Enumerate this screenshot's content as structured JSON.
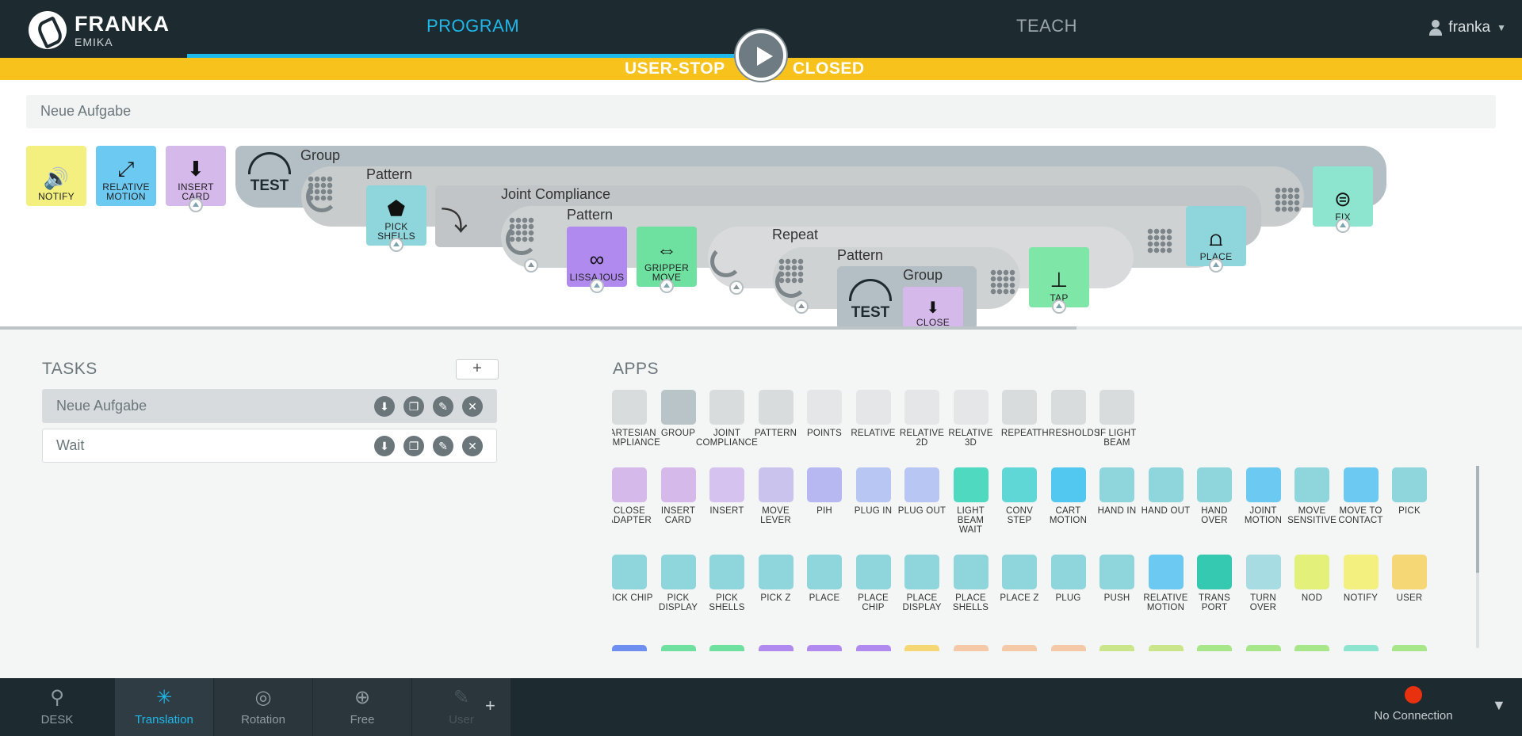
{
  "header": {
    "brand": "FRANKA",
    "brand_sub": "EMIKA",
    "tabs": [
      {
        "label": "PROGRAM",
        "active": true
      },
      {
        "label": "TEACH",
        "active": false
      }
    ],
    "user": "franka",
    "colors": {
      "bg": "#1d2a30",
      "accent": "#1fb8ea"
    }
  },
  "status": {
    "left": "USER-STOP",
    "right": "CLOSED",
    "color": "#f8c21c",
    "play_icon": "play-icon"
  },
  "task_name": "Neue Aufgabe",
  "timeline": {
    "tiles": [
      {
        "label": "NOTIFY",
        "color": "#f3f07f",
        "icon": "speaker-icon"
      },
      {
        "label": "RELATIVE MOTION",
        "color": "#6cc9f2",
        "icon": "relative-motion-icon"
      },
      {
        "label": "INSERT CARD",
        "color": "#d5b9ea",
        "icon": "insert-card-icon"
      },
      {
        "label": "PICK SHELLS",
        "color": "#8ed6dc",
        "icon": "gripper-icon"
      },
      {
        "label": "LISSAJOUS",
        "color": "#b18af0",
        "icon": "lissajous-icon"
      },
      {
        "label": "GRIPPER MOVE",
        "color": "#6ee0a0",
        "icon": "gripper-move-icon"
      },
      {
        "label": "CLOSE",
        "color": "#d5b9ea",
        "icon": "close-adapter-icon"
      },
      {
        "label": "TAP",
        "color": "#7ee6a6",
        "icon": "tap-icon"
      },
      {
        "label": "PLACE",
        "color": "#8ed6dc",
        "icon": "place-icon"
      },
      {
        "label": "FIX",
        "color": "#8de4cf",
        "icon": "fix-icon"
      }
    ],
    "groups": [
      "Group",
      "Pattern",
      "Joint Compliance",
      "Pattern",
      "Repeat",
      "Pattern",
      "Group"
    ],
    "test_label": "TEST"
  },
  "tasks": {
    "title": "TASKS",
    "add_label": "+",
    "items": [
      {
        "name": "Neue Aufgabe",
        "selected": true
      },
      {
        "name": "Wait",
        "selected": false
      }
    ],
    "action_icons": [
      "download-icon",
      "copy-icon",
      "edit-icon",
      "delete-icon"
    ]
  },
  "apps": {
    "title": "APPS",
    "items": [
      {
        "label": "CARTESIAN COMPLIANCE",
        "color": "#d9dcdd"
      },
      {
        "label": "GROUP",
        "color": "#b9c4c9"
      },
      {
        "label": "JOINT COMPLIANCE",
        "color": "#d9dcdd"
      },
      {
        "label": "PATTERN",
        "color": "#d9dcdd"
      },
      {
        "label": "POINTS",
        "color": "#e4e6e7"
      },
      {
        "label": "RELATIVE",
        "color": "#e4e6e7"
      },
      {
        "label": "RELATIVE 2D",
        "color": "#e4e6e7"
      },
      {
        "label": "RELATIVE 3D",
        "color": "#e4e6e7"
      },
      {
        "label": "REPEAT",
        "color": "#d9dcdd"
      },
      {
        "label": "THRESHOLDS",
        "color": "#d9dcdd"
      },
      {
        "label": "IF LIGHT BEAM",
        "color": "#d9dcdd"
      },
      {
        "label": "CLOSE ADAPTER",
        "color": "#d5b9ea"
      },
      {
        "label": "INSERT CARD",
        "color": "#d5b9ea"
      },
      {
        "label": "INSERT",
        "color": "#d5c2ee"
      },
      {
        "label": "MOVE LEVER",
        "color": "#c9c3ee"
      },
      {
        "label": "PIH",
        "color": "#b7b8f2"
      },
      {
        "label": "PLUG IN",
        "color": "#b7c6f2"
      },
      {
        "label": "PLUG OUT",
        "color": "#b7c6f2"
      },
      {
        "label": "LIGHT BEAM WAIT",
        "color": "#4fd9c1"
      },
      {
        "label": "CONV STEP",
        "color": "#5fd7d6"
      },
      {
        "label": "CART MOTION",
        "color": "#52c7ef"
      },
      {
        "label": "HAND IN",
        "color": "#8ed6dc"
      },
      {
        "label": "HAND OUT",
        "color": "#8ed6dc"
      },
      {
        "label": "HAND OVER",
        "color": "#8ed6dc"
      },
      {
        "label": "JOINT MOTION",
        "color": "#6cc9f2"
      },
      {
        "label": "MOVE SENSITIVE",
        "color": "#8ed6dc"
      },
      {
        "label": "MOVE TO CONTACT",
        "color": "#6cc9f2"
      },
      {
        "label": "PICK",
        "color": "#8ed6dc"
      },
      {
        "label": "PICK CHIP",
        "color": "#8ed6dc"
      },
      {
        "label": "PICK DISPLAY",
        "color": "#8ed6dc"
      },
      {
        "label": "PICK SHELLS",
        "color": "#8ed6dc"
      },
      {
        "label": "PICK Z",
        "color": "#8ed6dc"
      },
      {
        "label": "PLACE",
        "color": "#8ed6dc"
      },
      {
        "label": "PLACE CHIP",
        "color": "#8ed6dc"
      },
      {
        "label": "PLACE DISPLAY",
        "color": "#8ed6dc"
      },
      {
        "label": "PLACE SHELLS",
        "color": "#8ed6dc"
      },
      {
        "label": "PLACE Z",
        "color": "#8ed6dc"
      },
      {
        "label": "PLUG",
        "color": "#8ed6dc"
      },
      {
        "label": "PUSH",
        "color": "#8ed6dc"
      },
      {
        "label": "RELATIVE MOTION",
        "color": "#6cc9f2"
      },
      {
        "label": "TRANS PORT",
        "color": "#34c9b0"
      },
      {
        "label": "TURN OVER",
        "color": "#a7dce3"
      },
      {
        "label": "NOD",
        "color": "#e3f07a"
      },
      {
        "label": "NOTIFY",
        "color": "#f3f07f"
      },
      {
        "label": "USER",
        "color": "#f5d875"
      },
      {
        "label": "",
        "color": "#6e8ff0"
      },
      {
        "label": "",
        "color": "#6ee0a0"
      },
      {
        "label": "",
        "color": "#6ee0a0"
      },
      {
        "label": "",
        "color": "#b18af0"
      },
      {
        "label": "",
        "color": "#b18af0"
      },
      {
        "label": "",
        "color": "#b18af0"
      },
      {
        "label": "",
        "color": "#f5d875"
      },
      {
        "label": "",
        "color": "#f5c9a8"
      },
      {
        "label": "",
        "color": "#f5c9a8"
      },
      {
        "label": "",
        "color": "#f5c9a8"
      },
      {
        "label": "",
        "color": "#cbe58a"
      },
      {
        "label": "",
        "color": "#cbe58a"
      },
      {
        "label": "",
        "color": "#a8e68a"
      },
      {
        "label": "",
        "color": "#a8e68a"
      },
      {
        "label": "",
        "color": "#a8e68a"
      },
      {
        "label": "",
        "color": "#8de4cf"
      },
      {
        "label": "",
        "color": "#a8e68a"
      }
    ]
  },
  "bottombar": {
    "modes": [
      {
        "label": "DESK",
        "icon": "desk-icon"
      },
      {
        "label": "Translation",
        "icon": "translation-icon",
        "active": true
      },
      {
        "label": "Rotation",
        "icon": "rotation-icon"
      },
      {
        "label": "Free",
        "icon": "free-icon"
      },
      {
        "label": "User",
        "icon": "user-mode-icon"
      }
    ],
    "add_label": "+",
    "connection": "No Connection",
    "connection_color": "#e8320f"
  }
}
